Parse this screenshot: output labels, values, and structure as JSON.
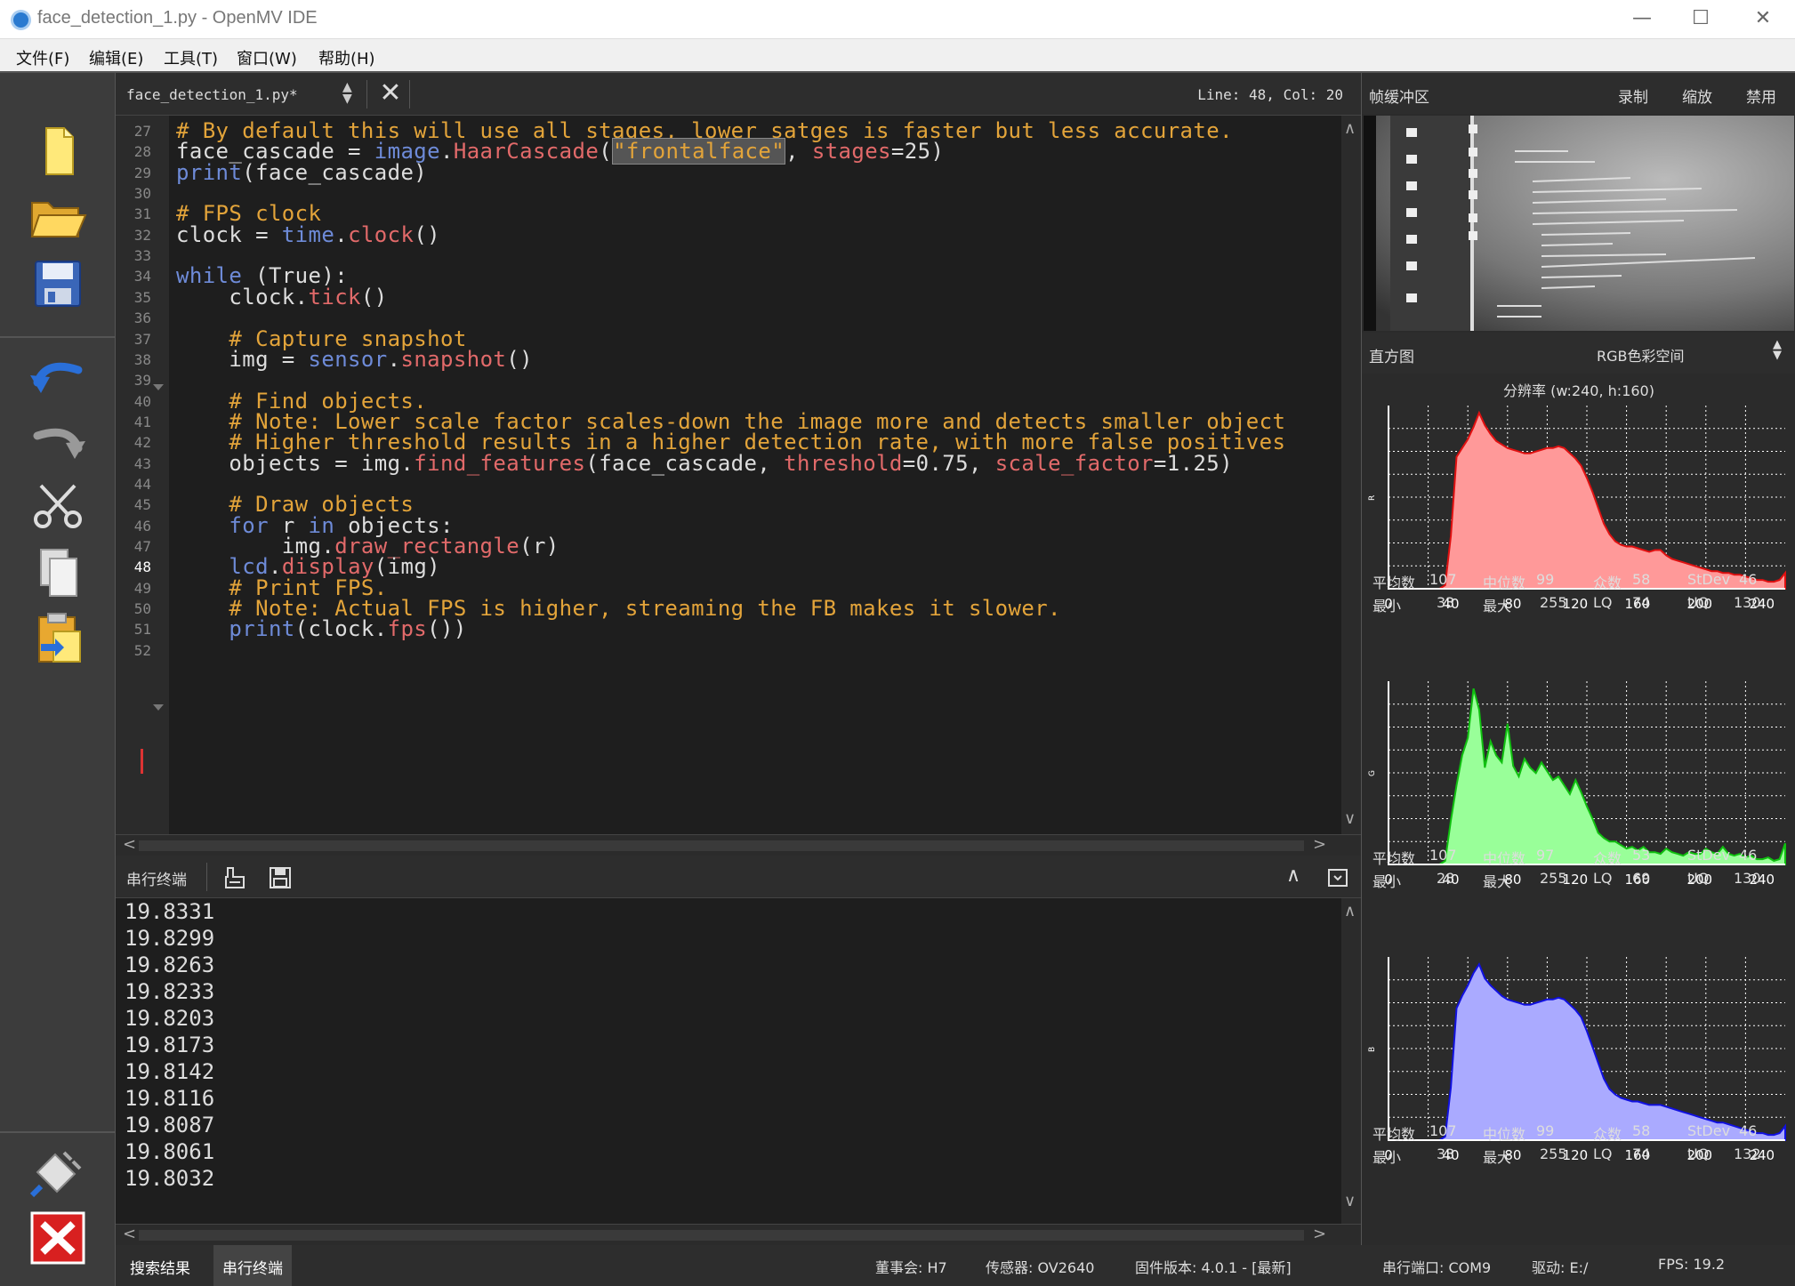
{
  "window": {
    "title": "face_detection_1.py - OpenMV IDE",
    "min": "—",
    "max": "☐",
    "close": "✕"
  },
  "menu": [
    "文件(F)",
    "编辑(E)",
    "工具(T)",
    "窗口(W)",
    "帮助(H)"
  ],
  "editor": {
    "tab_name": "face_detection_1.py*",
    "cursor_pos": "Line: 48, Col: 20",
    "lines": [
      {
        "n": "27",
        "t": "# By default this will use all stages, lower satges is faster but less accurate."
      },
      {
        "n": "28",
        "t": "face_cascade = image.HaarCascade(\"frontalface\", stages=25)"
      },
      {
        "n": "29",
        "t": "print(face_cascade)"
      },
      {
        "n": "30",
        "t": ""
      },
      {
        "n": "31",
        "t": "# FPS clock"
      },
      {
        "n": "32",
        "t": "clock = time.clock()"
      },
      {
        "n": "33",
        "t": ""
      },
      {
        "n": "34",
        "t": "while (True):"
      },
      {
        "n": "35",
        "t": "    clock.tick()"
      },
      {
        "n": "36",
        "t": ""
      },
      {
        "n": "37",
        "t": "    # Capture snapshot"
      },
      {
        "n": "38",
        "t": "    img = sensor.snapshot()"
      },
      {
        "n": "39",
        "t": ""
      },
      {
        "n": "40",
        "t": "    # Find objects."
      },
      {
        "n": "41",
        "t": "    # Note: Lower scale factor scales-down the image more and detects smaller object"
      },
      {
        "n": "42",
        "t": "    # Higher threshold results in a higher detection rate, with more false positives"
      },
      {
        "n": "43",
        "t": "    objects = img.find_features(face_cascade, threshold=0.75, scale_factor=1.25)"
      },
      {
        "n": "44",
        "t": ""
      },
      {
        "n": "45",
        "t": "    # Draw objects"
      },
      {
        "n": "46",
        "t": "    for r in objects:"
      },
      {
        "n": "47",
        "t": "        img.draw_rectangle(r)"
      },
      {
        "n": "48",
        "t": "    lcd.display(img)"
      },
      {
        "n": "49",
        "t": "    # Print FPS."
      },
      {
        "n": "50",
        "t": "    # Note: Actual FPS is higher, streaming the FB makes it slower."
      },
      {
        "n": "51",
        "t": "    print(clock.fps())"
      },
      {
        "n": "52",
        "t": ""
      }
    ],
    "current_line": "48"
  },
  "serial": {
    "label": "串行终端",
    "output": [
      "19.8331",
      "19.8299",
      "19.8263",
      "19.8233",
      "19.8203",
      "19.8173",
      "19.8142",
      "19.8116",
      "19.8087",
      "19.8061",
      "19.8032"
    ]
  },
  "status": {
    "tab_search": "搜索结果",
    "tab_serial": "串行终端",
    "board": "董事会: H7",
    "sensor": "传感器: OV2640",
    "firmware": "固件版本: 4.0.1 - [最新]",
    "port": "串行端口: COM9",
    "drive": "驱动: E:/",
    "fps": "FPS:  19.2"
  },
  "framebuffer": {
    "label": "帧缓冲区",
    "record": "录制",
    "zoom": "缩放",
    "disable": "禁用"
  },
  "histogram": {
    "label": "直方图",
    "colorspace": "RGB色彩空间",
    "resolution": "分辨率 (w:240, h:160)",
    "x_ticks": [
      "0",
      "40",
      "80",
      "120",
      "160",
      "200",
      "240"
    ],
    "channels": [
      {
        "name": "R",
        "color": "#ff9999",
        "stroke": "#e01010",
        "values": [
          0,
          0,
          0,
          0,
          0,
          0,
          0,
          0,
          0,
          0,
          2,
          30,
          75,
          80,
          85,
          92,
          100,
          93,
          88,
          84,
          82,
          80,
          79,
          78,
          77,
          77,
          78,
          79,
          80,
          80,
          81,
          80,
          77,
          74,
          70,
          63,
          55,
          46,
          37,
          31,
          27,
          25,
          24,
          24,
          23,
          22,
          21,
          22,
          22,
          19,
          17,
          16,
          15,
          14,
          13,
          12,
          11,
          10,
          10,
          9,
          9,
          8,
          8,
          7,
          6,
          5,
          5,
          4,
          4,
          5,
          9
        ],
        "stats": {
          "mean_l": "平均数",
          "mean": "107",
          "median_l": "中位数",
          "median": "99",
          "mode_l": "众数",
          "mode": "58",
          "std_l": "StDev",
          "std": "46",
          "min_l": "最小",
          "min": "33",
          "max_l": "最大",
          "max": "255",
          "lq_l": "LQ",
          "lq": "74",
          "uq_l": "UQ",
          "uq": "130"
        }
      },
      {
        "name": "G",
        "color": "#99ff99",
        "stroke": "#10c010",
        "values": [
          0,
          0,
          0,
          0,
          0,
          0,
          0,
          0,
          0,
          0,
          2,
          25,
          45,
          62,
          72,
          100,
          88,
          55,
          70,
          62,
          58,
          80,
          56,
          50,
          60,
          55,
          52,
          58,
          53,
          48,
          50,
          45,
          40,
          48,
          41,
          33,
          26,
          18,
          15,
          13,
          13,
          11,
          9,
          10,
          8,
          10,
          7,
          7,
          6,
          9,
          7,
          6,
          5,
          7,
          6,
          6,
          9,
          7,
          6,
          10,
          6,
          5,
          6,
          4,
          5,
          3,
          3,
          4,
          2,
          3,
          12
        ],
        "stats": {
          "mean_l": "平均数",
          "mean": "107",
          "median_l": "中位数",
          "median": "97",
          "mode_l": "众数",
          "mode": "53",
          "std_l": "StDev",
          "std": "46",
          "min_l": "最小",
          "min": "28",
          "max_l": "最大",
          "max": "255",
          "lq_l": "LQ",
          "lq": "69",
          "uq_l": "UQ",
          "uq": "130"
        }
      },
      {
        "name": "B",
        "color": "#aaaaff",
        "stroke": "#1010e0",
        "values": [
          0,
          0,
          0,
          0,
          0,
          0,
          0,
          0,
          0,
          0,
          2,
          30,
          75,
          82,
          88,
          95,
          100,
          92,
          88,
          85,
          82,
          80,
          79,
          78,
          77,
          77,
          78,
          79,
          80,
          80,
          81,
          80,
          77,
          74,
          70,
          62,
          53,
          44,
          35,
          29,
          26,
          24,
          23,
          22,
          22,
          21,
          20,
          20,
          20,
          19,
          18,
          17,
          16,
          15,
          14,
          13,
          12,
          11,
          10,
          10,
          9,
          8,
          7,
          6,
          5,
          4,
          4,
          3,
          3,
          4,
          8
        ],
        "stats": {
          "mean_l": "平均数",
          "mean": "107",
          "median_l": "中位数",
          "median": "99",
          "mode_l": "众数",
          "mode": "58",
          "std_l": "StDev",
          "std": "46",
          "min_l": "最小",
          "min": "33",
          "max_l": "最大",
          "max": "255",
          "lq_l": "LQ",
          "lq": "74",
          "uq_l": "UQ",
          "uq": "132"
        }
      }
    ]
  }
}
